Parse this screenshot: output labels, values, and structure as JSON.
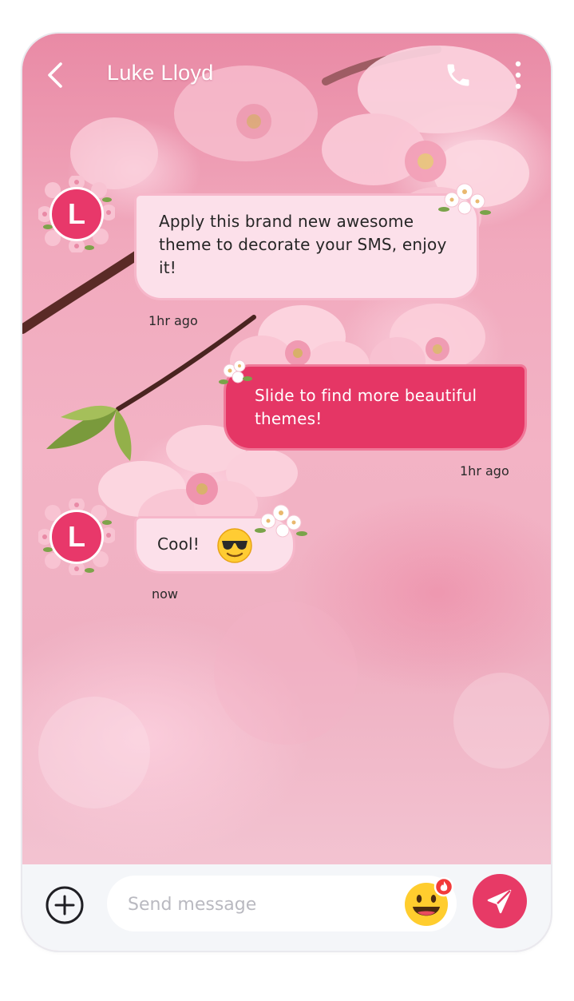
{
  "header": {
    "contact_name": "Luke Lloyd"
  },
  "messages": [
    {
      "direction": "incoming",
      "avatar_letter": "L",
      "text": "Apply this brand new awesome theme to decorate your SMS, enjoy it!",
      "time": "1hr ago"
    },
    {
      "direction": "outgoing",
      "text": "Slide to find more beautiful themes!",
      "time": "1hr ago"
    },
    {
      "direction": "incoming",
      "avatar_letter": "L",
      "text": "Cool!",
      "emoji": "smiling-face-with-sunglasses",
      "time": "now"
    }
  ],
  "composer": {
    "placeholder": "Send message"
  },
  "icons": {
    "back": "chevron-left-icon",
    "call": "phone-icon",
    "more": "more-vertical-icon",
    "add": "plus-circle-icon",
    "emoji": "grinning-face-icon",
    "send": "paper-plane-icon"
  },
  "colors": {
    "accent": "#e53665",
    "incoming_bubble": "#fce0ea",
    "outgoing_bubble": "#e53665",
    "input_bar": "#f4f6f9"
  }
}
